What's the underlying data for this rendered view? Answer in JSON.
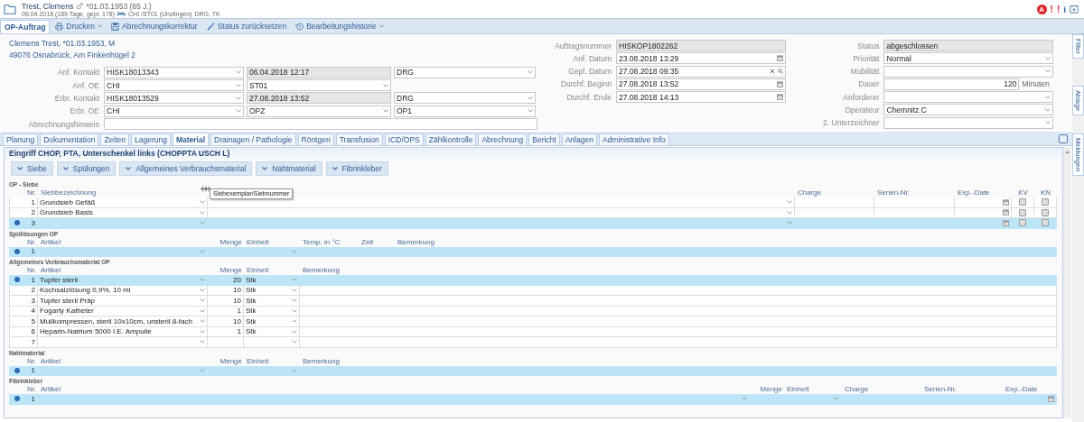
{
  "header": {
    "name": "Trest, Clemens",
    "birth": "*01.03.1953 (65 J.)",
    "stay": "06.04.2018 (189 Tage, gepl. 178)",
    "ward": "CHI /ST01 (Unzlingen)",
    "drg": "DRG: TK",
    "alerts": [
      {
        "kind": "badge",
        "text": "A"
      },
      {
        "kind": "warning",
        "text": "!"
      },
      {
        "kind": "warning",
        "text": "!"
      },
      {
        "kind": "info",
        "text": "i"
      }
    ]
  },
  "toolbar": {
    "tab": {
      "label": "OP-Auftrag",
      "selected": true
    },
    "actions": [
      {
        "label": "Drucken",
        "menu": true
      },
      {
        "label": "Abrechnungskorrektur",
        "menu": false
      },
      {
        "label": "Status zurücksetzen",
        "menu": false
      },
      {
        "label": "Bearbeitungshistorie",
        "menu": true
      }
    ]
  },
  "form": {
    "patient": [
      "Clemens Trest, *01.03.1953, M",
      "49076 Osnabrück, Am Finkenhügel 2"
    ],
    "left": [
      {
        "label": "Anf. Kontakt",
        "fields": [
          {
            "kind": "select",
            "value": "HISK18013343"
          },
          {
            "kind": "readonly",
            "value": "06.04.2018 12:17"
          },
          {
            "kind": "select",
            "value": "DRG"
          }
        ]
      },
      {
        "label": "Anf. OE",
        "fields": [
          {
            "kind": "select",
            "value": "CHI"
          },
          {
            "kind": "select",
            "value": "ST01"
          }
        ]
      },
      {
        "label": "Erbr. Kontakt",
        "fields": [
          {
            "kind": "select",
            "value": "HISK18013529"
          },
          {
            "kind": "readonly",
            "value": "27.08.2018 13:52"
          },
          {
            "kind": "select",
            "value": "DRG"
          }
        ]
      },
      {
        "label": "Erbr. OE",
        "fields": [
          {
            "kind": "select",
            "value": "CHI"
          },
          {
            "kind": "select",
            "value": "OPZ"
          },
          {
            "kind": "select",
            "value": "OP1"
          }
        ]
      },
      {
        "label": "Abrechnungshinweis",
        "fields": [
          {
            "kind": "text"
          }
        ]
      }
    ],
    "middle": [
      {
        "label": "Auftragsnummer",
        "fields": [
          {
            "kind": "readonly",
            "value": "HISKOP1802262"
          }
        ]
      },
      {
        "label": "Anf. Datum",
        "fields": [
          {
            "kind": "date",
            "value": "23.08.2018 13:29"
          }
        ]
      },
      {
        "label": "Gepl. Datum",
        "fields": [
          {
            "kind": "search",
            "value": "27.08.2018 09:35"
          }
        ]
      },
      {
        "label": "Durchf. Beginn",
        "fields": [
          {
            "kind": "date",
            "value": "27.08.2018 13:52"
          }
        ]
      },
      {
        "label": "Durchf. Ende",
        "fields": [
          {
            "kind": "date",
            "value": "27.08.2018 14:13"
          }
        ]
      }
    ],
    "right": [
      {
        "label": "Status",
        "fields": [
          {
            "kind": "readonly",
            "value": "abgeschlossen"
          }
        ]
      },
      {
        "label": "Priorität",
        "fields": [
          {
            "kind": "select",
            "value": "Normal"
          }
        ]
      },
      {
        "label": "Mobilität",
        "fields": [
          {
            "kind": "select"
          }
        ]
      },
      {
        "label": "Dauer",
        "fields": [
          {
            "kind": "number",
            "value": "120"
          }
        ],
        "unit": "Minuten"
      },
      {
        "label": "Anforderer",
        "fields": [
          {
            "kind": "select"
          }
        ]
      },
      {
        "label": "Operateur",
        "fields": [
          {
            "kind": "select",
            "value": "Chemnitz.C"
          }
        ]
      },
      {
        "label": "2. Unterzeichner",
        "fields": [
          {
            "kind": "select"
          }
        ]
      }
    ]
  },
  "side_tabs": [
    "Filter",
    "Ablage",
    "Meldungen"
  ],
  "tabs": [
    {
      "label": "Planung",
      "selected": false
    },
    {
      "label": "Dokumentation",
      "selected": false
    },
    {
      "label": "Zeiten",
      "selected": false
    },
    {
      "label": "Lagerung",
      "selected": false
    },
    {
      "label": "Material",
      "selected": true
    },
    {
      "label": "Drainagen / Pathologie",
      "selected": false
    },
    {
      "label": "Röntgen",
      "selected": false
    },
    {
      "label": "Transfusion",
      "selected": false
    },
    {
      "label": "ICD/OPS",
      "selected": false
    },
    {
      "label": "Zählkontrolle",
      "selected": false
    },
    {
      "label": "Abrechnung",
      "selected": false
    },
    {
      "label": "Bericht",
      "selected": false
    },
    {
      "label": "Anlagen",
      "selected": false
    },
    {
      "label": "Administrative Info",
      "selected": false
    }
  ],
  "panel_title": "Eingriff CHOP, PTA, Unterschenkel links (CHOPPTA USCH L)",
  "group_buttons": [
    "Siebe",
    "Spülungen",
    "Allgemeines Verbrauchsmaterial",
    "Nahtmaterial",
    "Fibrinkleber"
  ],
  "sections": [
    {
      "title": "OP - Siebe",
      "kind": "siebe",
      "columns": [
        {
          "label": "Nr.",
          "kind": "nr"
        },
        {
          "label": "Siebbezeichnung",
          "kind": "select"
        },
        {
          "kind": "select",
          "tooltip": "Siebexemplar/Siebnummer"
        },
        {
          "label": "Charge",
          "kind": "text"
        },
        {
          "label": "Serien-Nr.",
          "kind": "text"
        },
        {
          "label": "Exp.-Date",
          "kind": "date"
        },
        {
          "label": "KV",
          "kind": "check"
        },
        {
          "label": "KN",
          "kind": "check"
        }
      ],
      "rows": [
        {
          "selected": false,
          "cells": [
            "1",
            "Grundsieb Gefäß",
            null,
            null,
            null,
            null,
            false,
            false
          ]
        },
        {
          "selected": false,
          "cells": [
            "2",
            "Grundsieb Basis",
            null,
            null,
            null,
            null,
            false,
            false
          ]
        },
        {
          "selected": true,
          "cells": [
            "3",
            null,
            null,
            null,
            null,
            null,
            false,
            false
          ]
        }
      ]
    },
    {
      "title": "Spüllösungen OP",
      "kind": "spuel",
      "columns": [
        {
          "label": "Nr.",
          "kind": "nr"
        },
        {
          "label": "Artikel",
          "kind": "select"
        },
        {
          "label": "Menge",
          "kind": "number"
        },
        {
          "label": "Einheit",
          "kind": "select"
        },
        {
          "label": "Temp. in °C",
          "kind": "text"
        },
        {
          "label": "Zeit",
          "kind": "text"
        },
        {
          "label": "Bemerkung",
          "kind": "text"
        }
      ],
      "rows": [
        {
          "selected": true,
          "cells": [
            "1",
            null,
            null,
            null,
            null,
            null,
            null
          ]
        }
      ]
    },
    {
      "title": "Allgemeines Verbrauchsmaterial OP",
      "kind": "verbrauch",
      "columns": [
        {
          "label": "Nr.",
          "kind": "nr"
        },
        {
          "label": "Artikel",
          "kind": "select"
        },
        {
          "label": "Menge",
          "kind": "number"
        },
        {
          "label": "Einheit",
          "kind": "select"
        },
        {
          "label": "Bemerkung",
          "kind": "text"
        }
      ],
      "rows": [
        {
          "selected": true,
          "cells": [
            "1",
            "Tupfer steril",
            "20",
            "Stk",
            null
          ]
        },
        {
          "selected": false,
          "cells": [
            "2",
            "Kochsalzlösung 0,9%, 10 ml",
            "10",
            "Stk",
            null
          ]
        },
        {
          "selected": false,
          "cells": [
            "3",
            "Tupfer steril Präp",
            "10",
            "Stk",
            null
          ]
        },
        {
          "selected": false,
          "cells": [
            "4",
            "Fogarty Katheter",
            "1",
            "Stk",
            null
          ]
        },
        {
          "selected": false,
          "cells": [
            "5",
            "Mullkompressen, steril 10x10cm, unsteril 8-fach",
            "10",
            "Stk",
            null
          ]
        },
        {
          "selected": false,
          "cells": [
            "6",
            "Heparin-Natrium 5000 I.E. Ampulle",
            "1",
            "Stk",
            null
          ]
        },
        {
          "selected": false,
          "cells": [
            "7",
            null,
            null,
            null,
            null
          ]
        }
      ]
    },
    {
      "title": "Nahtmaterial",
      "kind": "verbrauch",
      "columns": [
        {
          "label": "Nr.",
          "kind": "nr"
        },
        {
          "label": "Artikel",
          "kind": "select"
        },
        {
          "label": "Menge",
          "kind": "number"
        },
        {
          "label": "Einheit",
          "kind": "select"
        },
        {
          "label": "Bemerkung",
          "kind": "text"
        }
      ],
      "rows": [
        {
          "selected": true,
          "cells": [
            "1",
            null,
            null,
            null,
            null
          ]
        }
      ]
    },
    {
      "title": "Fibrinkleber",
      "kind": "fibrin",
      "columns": [
        {
          "label": "Nr.",
          "kind": "nr"
        },
        {
          "label": "Artikel",
          "kind": "select"
        },
        {
          "label": "Menge",
          "kind": "number"
        },
        {
          "label": "Einheit",
          "kind": "select"
        },
        {
          "label": "Charge",
          "kind": "text"
        },
        {
          "label": "Serien-Nr.",
          "kind": "text"
        },
        {
          "label": "Exp.-Date",
          "kind": "date"
        }
      ],
      "rows": [
        {
          "selected": true,
          "cells": [
            "1",
            null,
            null,
            null,
            null,
            null,
            null
          ]
        }
      ]
    }
  ]
}
